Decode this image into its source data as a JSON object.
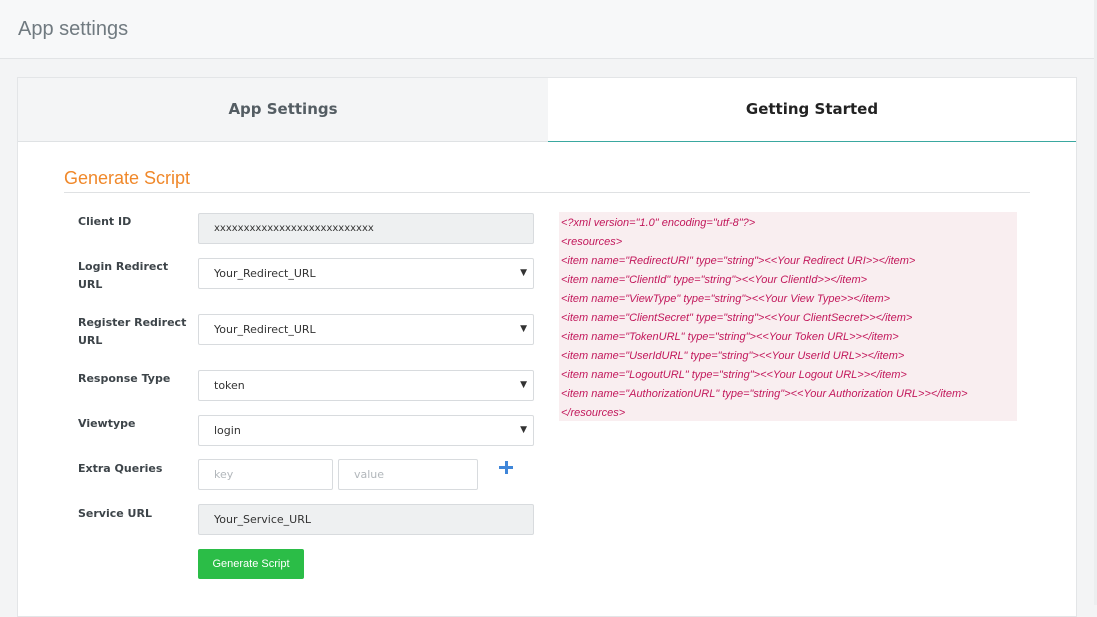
{
  "header": {
    "title": "App settings"
  },
  "tabs": [
    {
      "label": "App Settings",
      "active": false
    },
    {
      "label": "Getting Started",
      "active": true
    }
  ],
  "section": {
    "title": "Generate Script"
  },
  "form": {
    "client_id": {
      "label": "Client ID",
      "value": "xxxxxxxxxxxxxxxxxxxxxxxxxxx"
    },
    "login_redirect": {
      "label": "Login Redirect URL",
      "value": "Your_Redirect_URL"
    },
    "register_redirect": {
      "label": "Register Redirect URL",
      "value": "Your_Redirect_URL"
    },
    "response_type": {
      "label": "Response Type",
      "value": "token"
    },
    "viewtype": {
      "label": "Viewtype",
      "value": "login"
    },
    "extra_queries": {
      "label": "Extra Queries",
      "key_placeholder": "key",
      "value_placeholder": "value"
    },
    "service_url": {
      "label": "Service URL",
      "value": "Your_Service_URL"
    },
    "submit_label": "Generate Script"
  },
  "xml_lines": [
    "<?xml version=\"1.0\" encoding=\"utf-8\"?>",
    "<resources>",
    "<item name=\"RedirectURI\" type=\"string\"><<Your Redirect URI>></item>",
    "<item name=\"ClientId\" type=\"string\"><<Your ClientId>></item>",
    "<item name=\"ViewType\" type=\"string\"><<Your View Type>></item>",
    "<item name=\"ClientSecret\" type=\"string\"><<Your ClientSecret>></item>",
    "<item name=\"TokenURL\" type=\"string\"><<Your Token URL>></item>",
    "<item name=\"UserIdURL\" type=\"string\"><<Your UserId URL>></item>",
    "<item name=\"LogoutURL\" type=\"string\"><<Your Logout URL>></item>",
    "<item name=\"AuthorizationURL\" type=\"string\"><<Your Authorization URL>></item>",
    "</resources>"
  ],
  "colors": {
    "accent": "#f0882a",
    "tab_underline": "#3aa8a0",
    "button": "#2bbd47",
    "code": "#c2185b",
    "plus": "#3f86d9"
  },
  "icons": {
    "select_caret": "chevron-down-icon",
    "add": "plus-icon"
  }
}
